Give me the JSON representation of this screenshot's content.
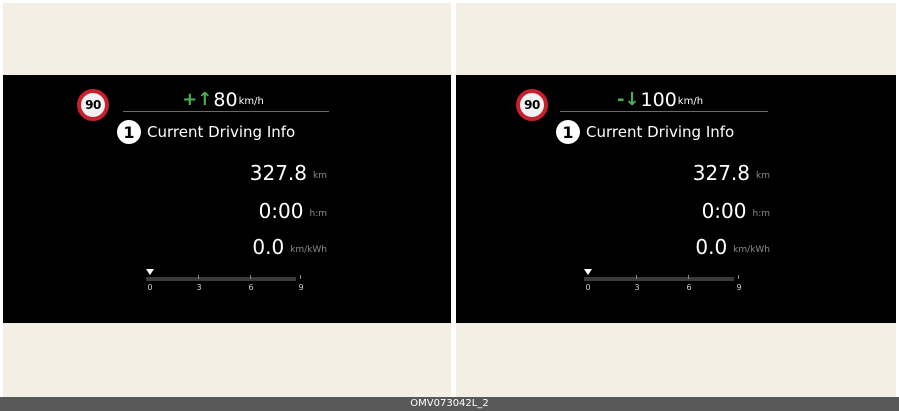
{
  "panels": [
    {
      "speed_limit": "90",
      "diff_sign": "+",
      "diff_arrow": "↑",
      "diff_value": "80",
      "diff_unit": "km/h",
      "badge": "1",
      "title": "Current Driving Info",
      "distance": {
        "value": "327.8",
        "unit": "km"
      },
      "time": {
        "value": "0:00",
        "unit": "h:m"
      },
      "efficiency": {
        "value": "0.0",
        "unit": "km/kWh"
      },
      "gauge_ticks": [
        "0",
        "3",
        "6",
        "9"
      ],
      "gauge_value": 0
    },
    {
      "speed_limit": "90",
      "diff_sign": "-",
      "diff_arrow": "↓",
      "diff_value": "100",
      "diff_unit": "km/h",
      "badge": "1",
      "title": "Current Driving Info",
      "distance": {
        "value": "327.8",
        "unit": "km"
      },
      "time": {
        "value": "0:00",
        "unit": "h:m"
      },
      "efficiency": {
        "value": "0.0",
        "unit": "km/kWh"
      },
      "gauge_ticks": [
        "0",
        "3",
        "6",
        "9"
      ],
      "gauge_value": 0
    }
  ],
  "caption": "OMV073042L_2",
  "colors": {
    "background": "#f4efe4",
    "screen": "#000000",
    "sign_ring": "#c8202e",
    "indicator_green": "#4caf50"
  }
}
